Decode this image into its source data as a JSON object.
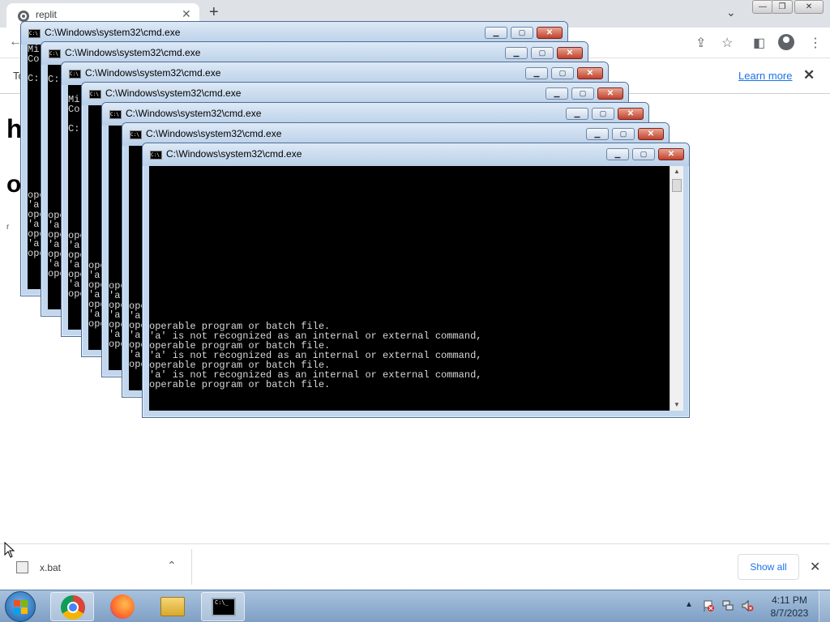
{
  "browser": {
    "tab_title": "replit",
    "tab_close": "✕",
    "new_tab": "+",
    "tab_search": "⌄",
    "window_controls": {
      "minimize": "—",
      "restore": "❐",
      "close": "✕"
    },
    "toolbar": {
      "back": "←",
      "share": "⇪",
      "bookmark": "☆",
      "sidepanel": "◧",
      "menu": "⋮"
    }
  },
  "infobar": {
    "text": "To",
    "learn_more": "Learn more",
    "close": "✕"
  },
  "page": {
    "heading_fragment": "h",
    "line_fragment": "o",
    "marker": "r"
  },
  "cmd_windows": [
    {
      "title": "C:\\Windows\\system32\\cmd.exe",
      "lines": [
        "Mi",
        "Co",
        "",
        "C:"
      ]
    },
    {
      "title": "C:\\Windows\\system32\\cmd.exe",
      "lines": [
        "",
        "C: Us"
      ]
    },
    {
      "title": "C:\\Windows\\system32\\cmd.exe",
      "lines": [
        "",
        "Mi",
        "Co",
        "",
        "C:"
      ]
    },
    {
      "title": "C:\\Windows\\system32\\cmd.exe",
      "lines": []
    },
    {
      "title": "C:\\Windows\\system32\\cmd.exe",
      "lines": []
    },
    {
      "title": "C:\\Windows\\system32\\cmd.exe",
      "lines": []
    },
    {
      "title": "C:\\Windows\\system32\\cmd.exe",
      "lines": []
    }
  ],
  "console_messages": {
    "operable": "operable program or batch file.",
    "not_recognized": "'a' is not recognized as an internal or external command,"
  },
  "cmd_controls": {
    "minimize": "▁",
    "maximize": "▢",
    "close": "✕"
  },
  "downloads": {
    "file_name": "x.bat",
    "chevron": "⌃",
    "show_all": "Show all",
    "close": "✕"
  },
  "taskbar": {
    "apps": [
      "chrome-icon",
      "firefox-icon",
      "explorer-icon",
      "cmd-icon"
    ],
    "tray_up": "▲",
    "time": "4:11 PM",
    "date": "8/7/2023"
  },
  "colors": {
    "console_bg": "#000000",
    "console_text": "#d8d8d8",
    "window_frame": "#c2d7ee",
    "taskbar": "#8fb0d2",
    "link": "#1a73e8"
  }
}
